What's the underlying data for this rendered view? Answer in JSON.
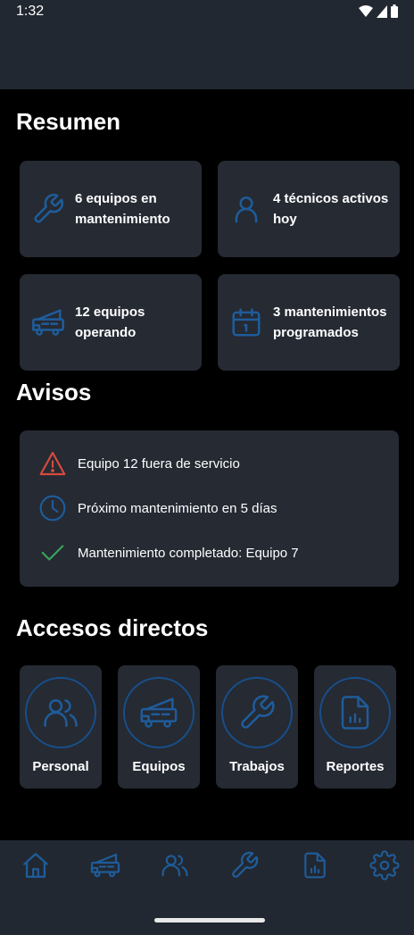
{
  "status_bar": {
    "time": "1:32"
  },
  "summary": {
    "title": "Resumen",
    "cards": [
      {
        "icon": "wrench-icon",
        "label": "6 equipos en mantenimiento"
      },
      {
        "icon": "person-icon",
        "label": "4 técnicos activos hoy"
      },
      {
        "icon": "crane-truck-icon",
        "label": "12 equipos operando"
      },
      {
        "icon": "calendar-icon",
        "label": "3 mantenimientos programados"
      }
    ]
  },
  "alerts": {
    "title": "Avisos",
    "items": [
      {
        "icon": "warning-icon",
        "text": "Equipo 12 fuera de servicio",
        "color": "#d84a3e"
      },
      {
        "icon": "clock-icon",
        "text": "Próximo mantenimiento en 5 días",
        "color": "#1f5c9a"
      },
      {
        "icon": "check-icon",
        "text": "Mantenimiento completado: Equipo 7",
        "color": "#38a35a"
      }
    ]
  },
  "shortcuts": {
    "title": "Accesos directos",
    "items": [
      {
        "icon": "people-icon",
        "label": "Personal"
      },
      {
        "icon": "crane-truck-icon",
        "label": "Equipos"
      },
      {
        "icon": "wrench-icon",
        "label": "Trabajos"
      },
      {
        "icon": "report-icon",
        "label": "Reportes"
      }
    ]
  },
  "bottom_nav": {
    "items": [
      {
        "icon": "home-icon"
      },
      {
        "icon": "crane-truck-icon"
      },
      {
        "icon": "people-icon"
      },
      {
        "icon": "wrench-icon"
      },
      {
        "icon": "report-icon"
      },
      {
        "icon": "gear-icon"
      }
    ]
  },
  "colors": {
    "accent": "#1f5c9a",
    "card_bg": "#252a33",
    "bar_bg": "#222831",
    "background": "#000000"
  }
}
